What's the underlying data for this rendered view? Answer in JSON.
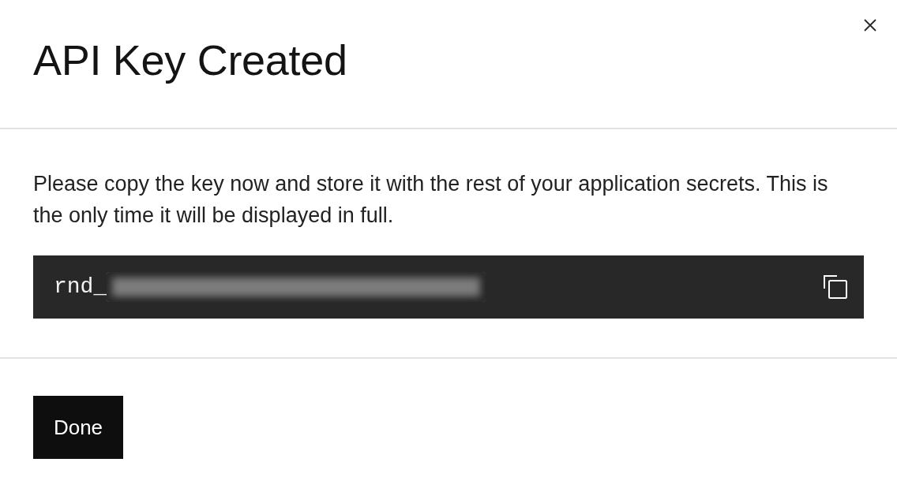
{
  "dialog": {
    "title": "API Key Created",
    "message": "Please copy the key now and store it with the rest of your application secrets. This is the only time it will be displayed in full.",
    "api_key": {
      "prefix": "rnd_",
      "masked": true
    },
    "buttons": [
      {
        "label": "Done"
      }
    ]
  }
}
